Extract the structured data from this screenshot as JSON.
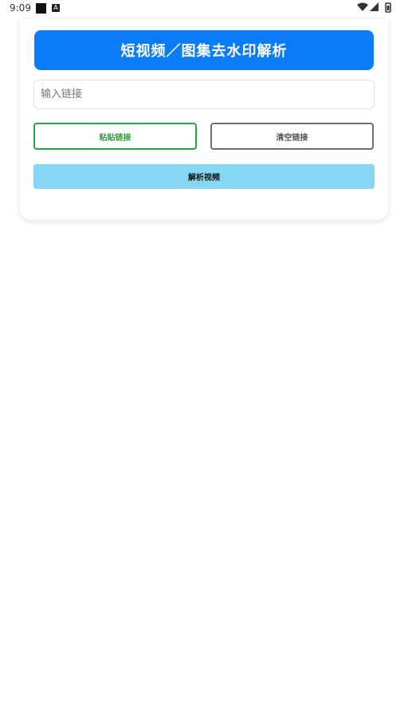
{
  "status_bar": {
    "time": "9:09",
    "notification_letter": "A"
  },
  "card": {
    "title": "短视频／图集去水印解析",
    "input_placeholder": "输入链接",
    "input_value": "",
    "paste_label": "粘贴链接",
    "clear_label": "清空链接",
    "parse_label": "解析视频"
  },
  "colors": {
    "title_bg": "#0a7cf7",
    "paste_border": "#2ea044",
    "clear_border": "#6b6f73",
    "parse_bg": "#85d7f3"
  }
}
